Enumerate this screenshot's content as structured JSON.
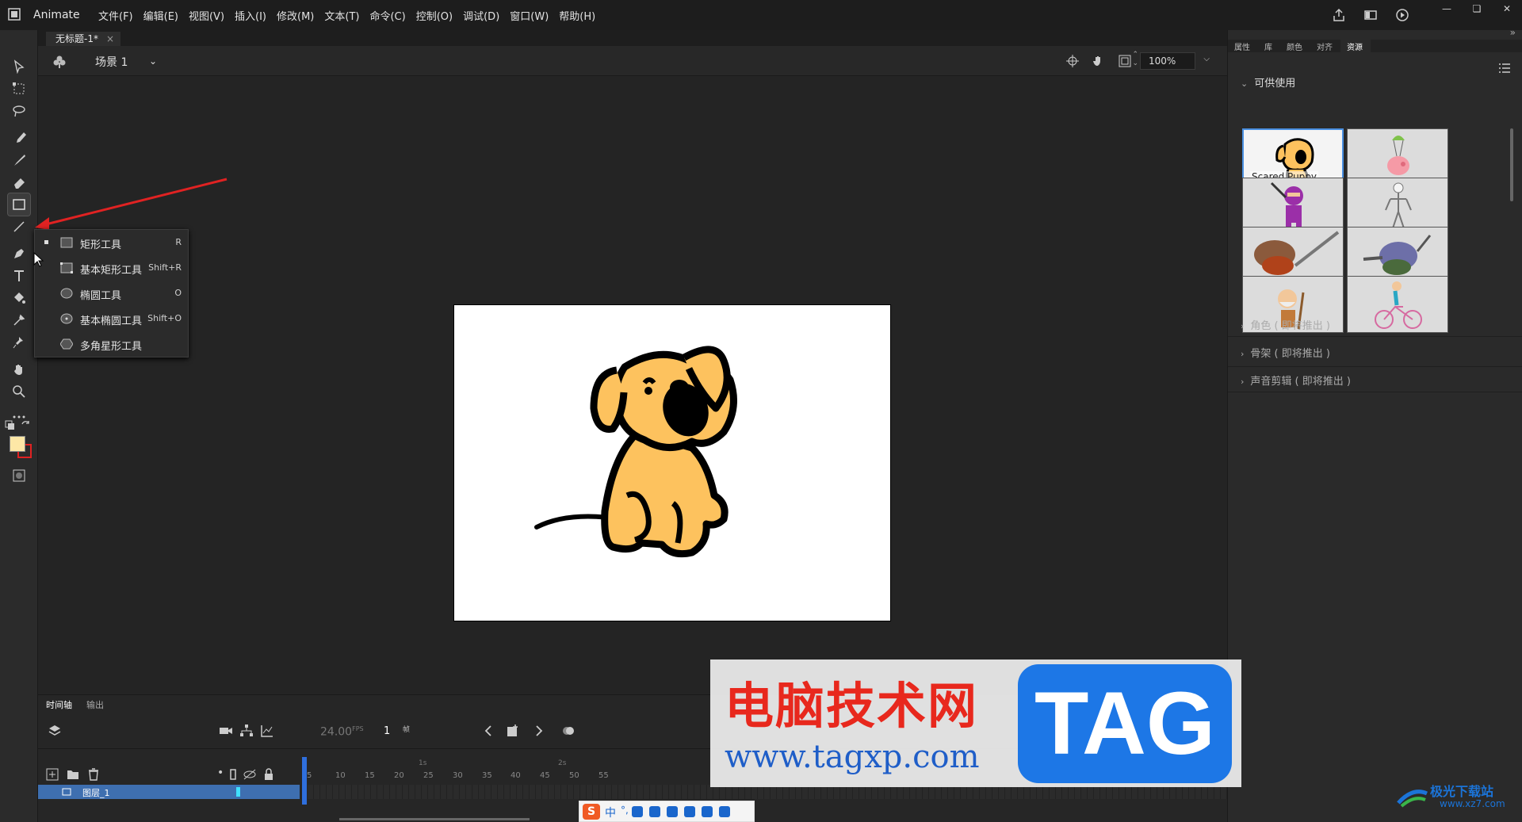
{
  "app": {
    "name": "Animate",
    "menus": [
      "文件(F)",
      "编辑(E)",
      "视图(V)",
      "插入(I)",
      "修改(M)",
      "文本(T)",
      "命令(C)",
      "控制(O)",
      "调试(D)",
      "窗口(W)",
      "帮助(H)"
    ]
  },
  "document": {
    "tab_title": "无标题-1*",
    "tab_close": "×",
    "scene_label": "场景 1",
    "zoom": "100%"
  },
  "tool_popup": {
    "items": [
      {
        "label": "矩形工具",
        "shortcut": "R",
        "icon": "rectangle-icon",
        "selected": true
      },
      {
        "label": "基本矩形工具",
        "shortcut": "Shift+R",
        "icon": "primitive-rectangle-icon"
      },
      {
        "label": "椭圆工具",
        "shortcut": "O",
        "icon": "oval-icon"
      },
      {
        "label": "基本椭圆工具",
        "shortcut": "Shift+O",
        "icon": "primitive-oval-icon"
      },
      {
        "label": "多角星形工具",
        "shortcut": "",
        "icon": "polystar-icon"
      }
    ]
  },
  "right_panel": {
    "tabs": [
      "属性",
      "库",
      "颜色",
      "对齐",
      "资源"
    ],
    "active_tab": "资源",
    "available_section": "可供使用",
    "assets": [
      {
        "label": "Scared Puppy",
        "icon": "puppy-thumbnail"
      },
      {
        "label": "",
        "icon": "parachute-pig-thumbnail"
      },
      {
        "label": "",
        "icon": "ninja-thumbnail"
      },
      {
        "label": "",
        "icon": "skeleton-thumbnail"
      },
      {
        "label": "",
        "icon": "warrior-thumbnail"
      },
      {
        "label": "",
        "icon": "robot-creature-thumbnail"
      },
      {
        "label": "",
        "icon": "old-man-thumbnail"
      },
      {
        "label": "",
        "icon": "bicycle-girl-thumbnail"
      }
    ],
    "collapsed_sections": [
      "角色 ( 即将推出 )",
      "骨架 ( 即将推出 )",
      "声音剪辑 ( 即将推出 )"
    ]
  },
  "timeline": {
    "tabs": [
      "时间轴",
      "输出"
    ],
    "fps": "24.00",
    "fps_unit": "FPS",
    "current_frame": "1",
    "frame_unit": "帧",
    "layer_name": "图层_1",
    "ruler_seconds": [
      "1s",
      "2s"
    ],
    "ruler_frames": [
      "5",
      "10",
      "15",
      "20",
      "25",
      "30",
      "35",
      "40",
      "45",
      "50",
      "55"
    ]
  },
  "watermark": {
    "site_title": "电脑技术网",
    "url": "www.tagxp.com",
    "tag": "TAG",
    "corner_text": "极光下载站",
    "corner_url": "www.xz7.com"
  },
  "ime": {
    "logo": "S",
    "mode": "中"
  },
  "colors": {
    "fill": "#fde7a6",
    "stroke": "#e02222",
    "accent": "#4a90e2",
    "layer_selected": "#3e6fb0"
  }
}
